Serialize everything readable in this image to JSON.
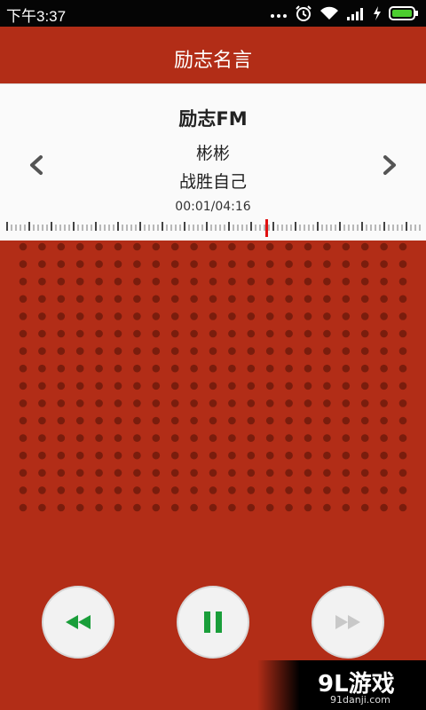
{
  "status_bar": {
    "time": "下午3:37",
    "icons": [
      "more-icon",
      "alarm-icon",
      "wifi-icon",
      "signal-icon",
      "charging-icon",
      "battery-icon"
    ]
  },
  "header": {
    "title": "励志名言"
  },
  "player": {
    "station": "励志FM",
    "artist": "彬彬",
    "track": "战胜自己",
    "time": "00:01/04:16",
    "progress_fraction": 0.004
  },
  "controls": {
    "rewind": "rewind-icon",
    "pause": "pause-icon",
    "fast_forward": "fast-forward-icon"
  },
  "watermark": {
    "logo": "9L游戏",
    "site": "91danji.com"
  },
  "colors": {
    "background": "#b22d17",
    "accent_green": "#1a9e3a",
    "needle": "#e01010",
    "panel": "#fafafa"
  }
}
